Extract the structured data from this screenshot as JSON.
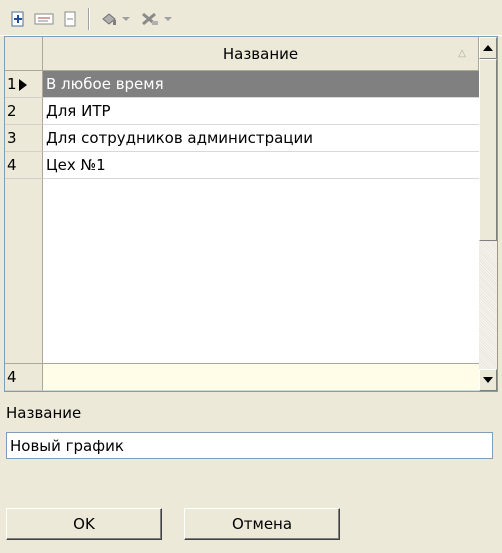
{
  "toolbar": {
    "icons": [
      "add-record-icon",
      "spellcheck-icon",
      "document-icon",
      "paint-icon",
      "delete-icon"
    ]
  },
  "grid": {
    "column_header": "Название",
    "rows": [
      {
        "num": "1",
        "name": "В любое время",
        "selected": true
      },
      {
        "num": "2",
        "name": "Для ИТР"
      },
      {
        "num": "3",
        "name": "Для сотрудников администрации"
      },
      {
        "num": "4",
        "name": "Цех №1"
      }
    ],
    "new_row_num": "4"
  },
  "form": {
    "name_label": "Название",
    "name_value": "Новый график"
  },
  "buttons": {
    "ok": "OK",
    "cancel": "Отмена"
  },
  "colors": {
    "selected_row": "#808080",
    "new_row": "#fffde8",
    "window_bg": "#ece9d8"
  }
}
